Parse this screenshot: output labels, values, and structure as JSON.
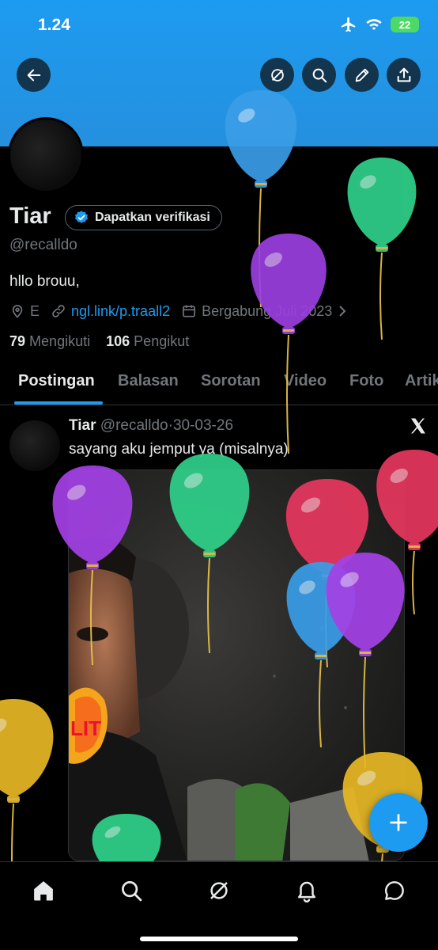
{
  "status_bar": {
    "time": "1.24",
    "battery": "22"
  },
  "header": {
    "back_icon": "arrow-left-icon",
    "buttons": [
      "grok-icon",
      "search-icon",
      "edit-icon",
      "share-icon"
    ]
  },
  "profile": {
    "name": "Tiar",
    "verify_label": "Dapatkan verifikasi",
    "handle": "@recalldo",
    "bio": "hllo brouu,",
    "location": "E",
    "link": "ngl.link/p.traall2",
    "joined": "Bergabung Juli 2023",
    "following_count": "79",
    "following_label": "Mengikuti",
    "followers_count": "106",
    "followers_label": "Pengikut"
  },
  "tabs": [
    "Postingan",
    "Balasan",
    "Sorotan",
    "Video",
    "Foto",
    "Artik"
  ],
  "post": {
    "name": "Tiar",
    "handle": "@recalldo",
    "date": "30-03-26",
    "text": "sayang aku jemput ya (misalnya)",
    "badge": "LIT"
  },
  "colors": {
    "accent": "#1d9bf0",
    "background": "#000000",
    "muted": "#71767b",
    "text": "#e7e9ea"
  },
  "bottom_nav": [
    "home-icon",
    "search-icon",
    "grok-icon",
    "notifications-icon",
    "messages-icon"
  ],
  "fab_icon": "plus-icon"
}
